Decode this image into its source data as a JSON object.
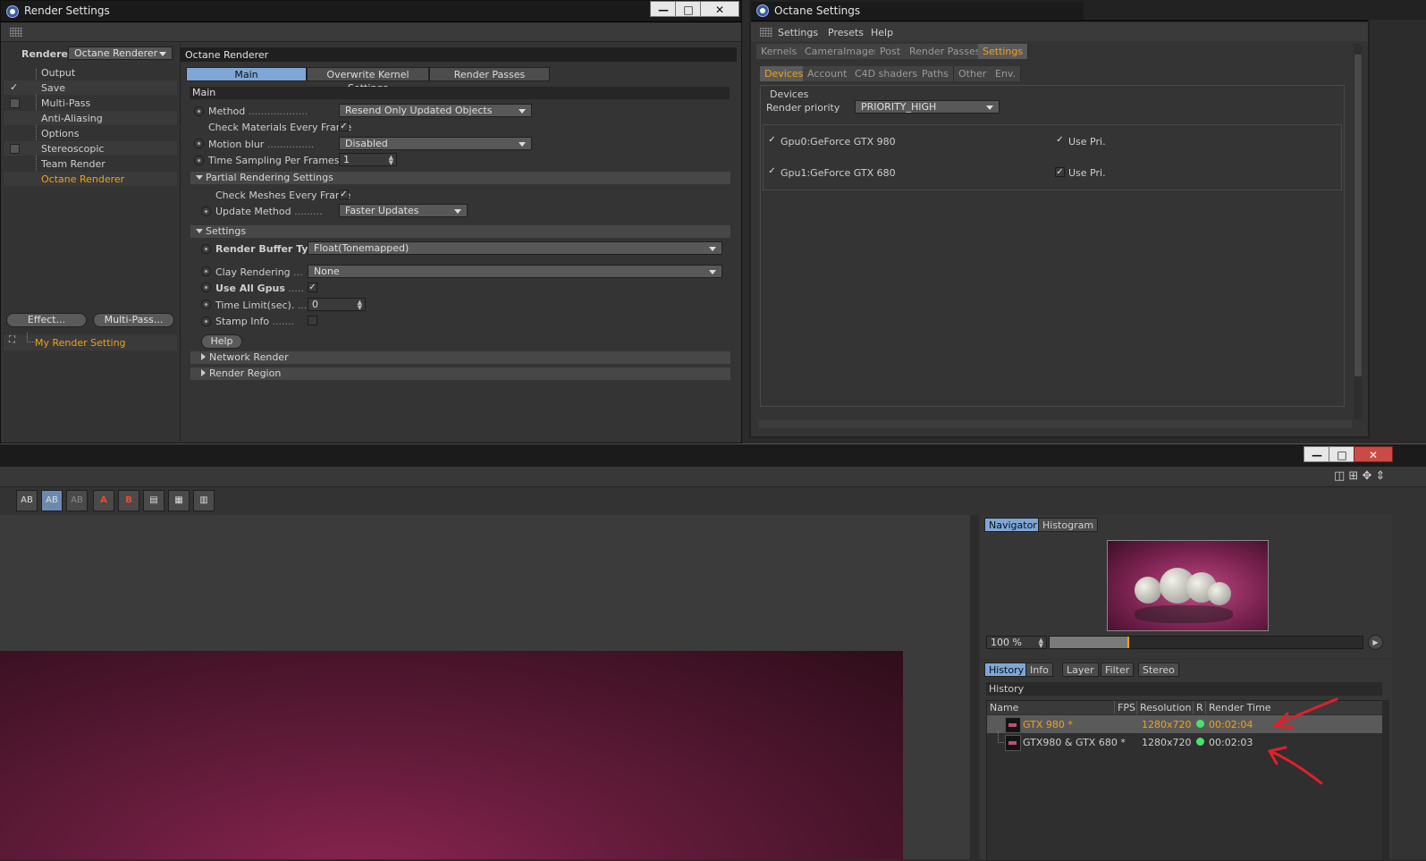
{
  "render_settings": {
    "title": "Render Settings",
    "renderer_label": "Renderer",
    "renderer_value": "Octane Renderer",
    "tree": [
      {
        "label": "Output",
        "check": ""
      },
      {
        "label": "Save",
        "check": "✓"
      },
      {
        "label": "Multi-Pass",
        "check": "box"
      },
      {
        "label": "Anti-Aliasing",
        "check": ""
      },
      {
        "label": "Options",
        "check": ""
      },
      {
        "label": "Stereoscopic",
        "check": "box"
      },
      {
        "label": "Team Render",
        "check": ""
      },
      {
        "label": "Octane Renderer",
        "check": ""
      }
    ],
    "effect_button": "Effect...",
    "multipass_button": "Multi-Pass...",
    "setting_name": "My Render Setting",
    "panel_title": "Octane Renderer",
    "tabs": [
      "Main",
      "Overwrite Kernel Settings",
      "Render Passes"
    ],
    "main_header": "Main",
    "method_label": "Method",
    "method_value": "Resend Only Updated Objects",
    "check_materials_label": "Check Materials Every Frame",
    "motion_blur_label": "Motion blur",
    "motion_blur_value": "Disabled",
    "time_sampling_label": "Time Sampling Per Frames",
    "time_sampling_value": "1",
    "partial_section": "Partial Rendering Settings",
    "check_meshes_label": "Check Meshes Every Frame",
    "update_method_label": "Update Method",
    "update_method_value": "Faster Updates",
    "settings_section": "Settings",
    "buffer_label": "Render Buffer Type",
    "buffer_value": "Float(Tonemapped)",
    "clay_label": "Clay Rendering",
    "clay_value": "None",
    "use_all_gpus_label": "Use All Gpus",
    "time_limit_label": "Time Limit(sec).",
    "time_limit_value": "0",
    "stamp_label": "Stamp Info",
    "help_button": "Help",
    "network_section": "Network Render",
    "region_section": "Render Region"
  },
  "octane_settings": {
    "title": "Octane Settings",
    "menu": [
      "Settings",
      "Presets",
      "Help"
    ],
    "tabs": [
      "Kernels",
      "CameraImager",
      "Post",
      "Render Passes",
      "Settings"
    ],
    "active_tab": "Settings",
    "subtabs": [
      "Devices",
      "Account",
      "C4D shaders",
      "Paths",
      "Other",
      "Env."
    ],
    "active_subtab": "Devices",
    "group_label": "Devices",
    "priority_label": "Render priority",
    "priority_value": "PRIORITY_HIGH",
    "gpus": [
      {
        "name": "Gpu0:GeForce GTX 980",
        "use_pri": "Use Pri."
      },
      {
        "name": "Gpu1:GeForce GTX 680",
        "use_pri": "Use Pri."
      }
    ]
  },
  "picture_viewer": {
    "navigator_tabs": [
      "Navigator",
      "Histogram"
    ],
    "zoom": "100 %",
    "history_tabs": [
      "History",
      "Info",
      "Layer",
      "Filter",
      "Stereo"
    ],
    "history_header": "History",
    "columns": [
      "Name",
      "FPS",
      "Resolution",
      "R",
      "Render Time"
    ],
    "rows": [
      {
        "name": "GTX 980 *",
        "resolution": "1280x720",
        "time": "00:02:04",
        "active": true
      },
      {
        "name": "GTX980 & GTX 680 *",
        "resolution": "1280x720",
        "time": "00:02:03",
        "active": false
      }
    ],
    "toolbar_icons": [
      "compare-ab-icon",
      "swap-ab-icon",
      "ab-icon",
      "set-a-icon",
      "set-b-icon",
      "layout1-icon",
      "layout2-icon",
      "layout3-icon"
    ]
  },
  "colors": {
    "accent_orange": "#f0a11a",
    "tab_blue": "#7ea7d8",
    "status_green": "#46e36f",
    "annotation_red": "#e0202a"
  }
}
